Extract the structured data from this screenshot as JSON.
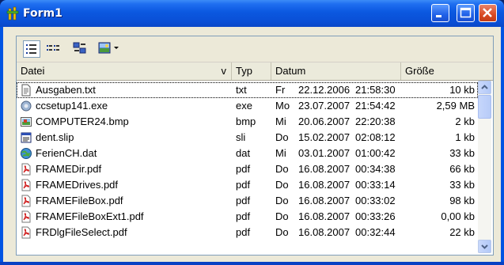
{
  "window": {
    "title": "Form1"
  },
  "toolbar": {
    "buttons": [
      "details-view",
      "list-view",
      "small-icons-view",
      "image-view"
    ]
  },
  "columns": {
    "name": "Datei",
    "name_sort": "v",
    "type": "Typ",
    "date": "Datum",
    "size": "Größe"
  },
  "files": [
    {
      "name": "Ausgaben.txt",
      "type": "txt",
      "day": "Fr",
      "date": "22.12.2006",
      "time": "21:58:30",
      "size": "10 kb",
      "icon": "text-file-icon"
    },
    {
      "name": "ccsetup141.exe",
      "type": "exe",
      "day": "Mo",
      "date": "23.07.2007",
      "time": "21:54:42",
      "size": "2,59 MB",
      "icon": "exe-file-icon"
    },
    {
      "name": "COMPUTER24.bmp",
      "type": "bmp",
      "day": "Mi",
      "date": "20.06.2007",
      "time": "22:20:38",
      "size": "2 kb",
      "icon": "bitmap-file-icon"
    },
    {
      "name": "dent.slip",
      "type": "sli",
      "day": "Do",
      "date": "15.02.2007",
      "time": "02:08:12",
      "size": "1 kb",
      "icon": "slip-file-icon"
    },
    {
      "name": "FerienCH.dat",
      "type": "dat",
      "day": "Mi",
      "date": "03.01.2007",
      "time": "01:00:42",
      "size": "33 kb",
      "icon": "dat-file-icon"
    },
    {
      "name": "FRAMEDir.pdf",
      "type": "pdf",
      "day": "Do",
      "date": "16.08.2007",
      "time": "00:34:38",
      "size": "66 kb",
      "icon": "pdf-file-icon"
    },
    {
      "name": "FRAMEDrives.pdf",
      "type": "pdf",
      "day": "Do",
      "date": "16.08.2007",
      "time": "00:33:14",
      "size": "33 kb",
      "icon": "pdf-file-icon"
    },
    {
      "name": "FRAMEFileBox.pdf",
      "type": "pdf",
      "day": "Do",
      "date": "16.08.2007",
      "time": "00:33:02",
      "size": "98 kb",
      "icon": "pdf-file-icon"
    },
    {
      "name": "FRAMEFileBoxExt1.pdf",
      "type": "pdf",
      "day": "Do",
      "date": "16.08.2007",
      "time": "00:33:26",
      "size": "0,00 kb",
      "icon": "pdf-file-icon"
    },
    {
      "name": "FRDlgFileSelect.pdf",
      "type": "pdf",
      "day": "Do",
      "date": "16.08.2007",
      "time": "00:32:44",
      "size": "22 kb",
      "icon": "pdf-file-icon"
    }
  ]
}
